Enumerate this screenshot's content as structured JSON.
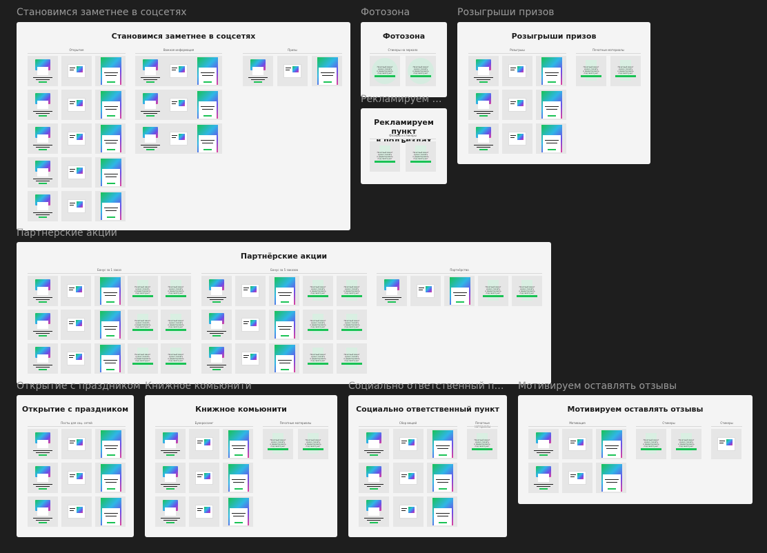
{
  "canvas": {
    "background": "#1e1e1e",
    "board_background": "#f4f4f4",
    "accent": "#19c254",
    "tile_background": "#e6e6e6"
  },
  "boards": [
    {
      "id": "social",
      "frame_label": "Становимся заметнее в соцсетях",
      "title": "Становимся заметнее в соцсетях",
      "groups": [
        {
          "title": "Открытие",
          "tiles": [
            "ap",
            "ph",
            "pc",
            "ap",
            "ph",
            "pc",
            "ap",
            "ph",
            "pc",
            "ap",
            "ph",
            "pc",
            "ap",
            "ph",
            "pc"
          ]
        },
        {
          "title": "Важная информация",
          "tiles": [
            "ap",
            "ph",
            "pc",
            "ap",
            "ph",
            "pc",
            "ap",
            "ph",
            "pc"
          ]
        },
        {
          "title": "Призы",
          "tiles": [
            "ap",
            "ph",
            "pc"
          ]
        }
      ]
    },
    {
      "id": "photozone",
      "frame_label": "Фотозона",
      "title": "Фотозона",
      "groups": [
        {
          "title": "Стикеры на зеркало",
          "tiles": [
            "ci",
            "ci"
          ]
        }
      ]
    },
    {
      "id": "prizes",
      "frame_label": "Розыгрыши призов",
      "title": "Розыгрыши призов",
      "groups": [
        {
          "title": "Розыгрыш",
          "tiles": [
            "ap",
            "ph",
            "pc",
            "ap",
            "ph",
            "pc",
            "ap",
            "ph",
            "pc"
          ]
        },
        {
          "title": "Печатные материалы",
          "tiles": [
            "tp",
            "tp"
          ]
        }
      ]
    },
    {
      "id": "entrances",
      "frame_label": "Рекламируем пу...",
      "title": "Рекламируем пункт\nв подъездах",
      "groups": [
        {
          "title": "Флаеры и стикеры",
          "tiles": [
            "tp",
            "tp"
          ]
        }
      ]
    },
    {
      "id": "partners",
      "frame_label": "Партнерские акции",
      "title": "Партнёрские акции",
      "groups": [
        {
          "title": "Бонус за 1 заказ",
          "tiles": [
            "ap",
            "ph",
            "pc",
            "tp",
            "tp",
            "ap",
            "ph",
            "pc",
            "tp",
            "tp",
            "ap",
            "ph",
            "pc",
            "tp",
            "tp"
          ]
        },
        {
          "title": "Бонус за 5 заказов",
          "tiles": [
            "ap",
            "ph",
            "pc",
            "tp",
            "tp",
            "ap",
            "ph",
            "pc",
            "tp",
            "tp",
            "ap",
            "ph",
            "pc",
            "tp",
            "tp"
          ]
        },
        {
          "title": "Партнёрство",
          "tiles": [
            "ap",
            "ph",
            "pc",
            "tp",
            "tp"
          ]
        }
      ]
    },
    {
      "id": "holiday",
      "frame_label": "Открытие с праздником",
      "title": "Открытие с праздником",
      "groups": [
        {
          "title": "Посты для соц. сетей",
          "tiles": [
            "ap",
            "ph",
            "pc",
            "ap",
            "ph",
            "pc",
            "ap",
            "ph",
            "pc"
          ]
        }
      ]
    },
    {
      "id": "books",
      "frame_label": "Книжное комьюнити",
      "title": "Книжное комьюнити",
      "groups": [
        {
          "title": "Буккроссинг",
          "tiles": [
            "ap",
            "ph",
            "pc",
            "ap",
            "ph",
            "pc",
            "ap",
            "ph",
            "pc"
          ]
        },
        {
          "title": "Печатные материалы",
          "tiles": [
            "tp",
            "tp"
          ]
        }
      ]
    },
    {
      "id": "social-resp",
      "frame_label": "Социально ответственный пункт",
      "title": "Социально ответственный пункт",
      "groups": [
        {
          "title": "Сбор вещей",
          "tiles": [
            "ap",
            "ph",
            "pc",
            "ap",
            "ph",
            "pc",
            "ap",
            "ph",
            "pc"
          ]
        },
        {
          "title": "Печатные материалы",
          "tiles": [
            "tp"
          ]
        }
      ]
    },
    {
      "id": "reviews",
      "frame_label": "Мотивируем оставлять отзывы",
      "title": "Мотивируем оставлять отзывы",
      "groups": [
        {
          "title": "Мотивация",
          "tiles": [
            "ap",
            "ph",
            "pc",
            "ap",
            "ph",
            "pc"
          ]
        },
        {
          "title": "Стикеры",
          "tiles": [
            "tp",
            "tp"
          ]
        },
        {
          "title": "Стикеры",
          "tiles": [
            "ph"
          ]
        }
      ]
    }
  ],
  "tile_text": {
    "poster_lines": [
      "Печатный макет",
      "нужно скачать",
      "и редактировать",
      "под свой пункт"
    ]
  }
}
